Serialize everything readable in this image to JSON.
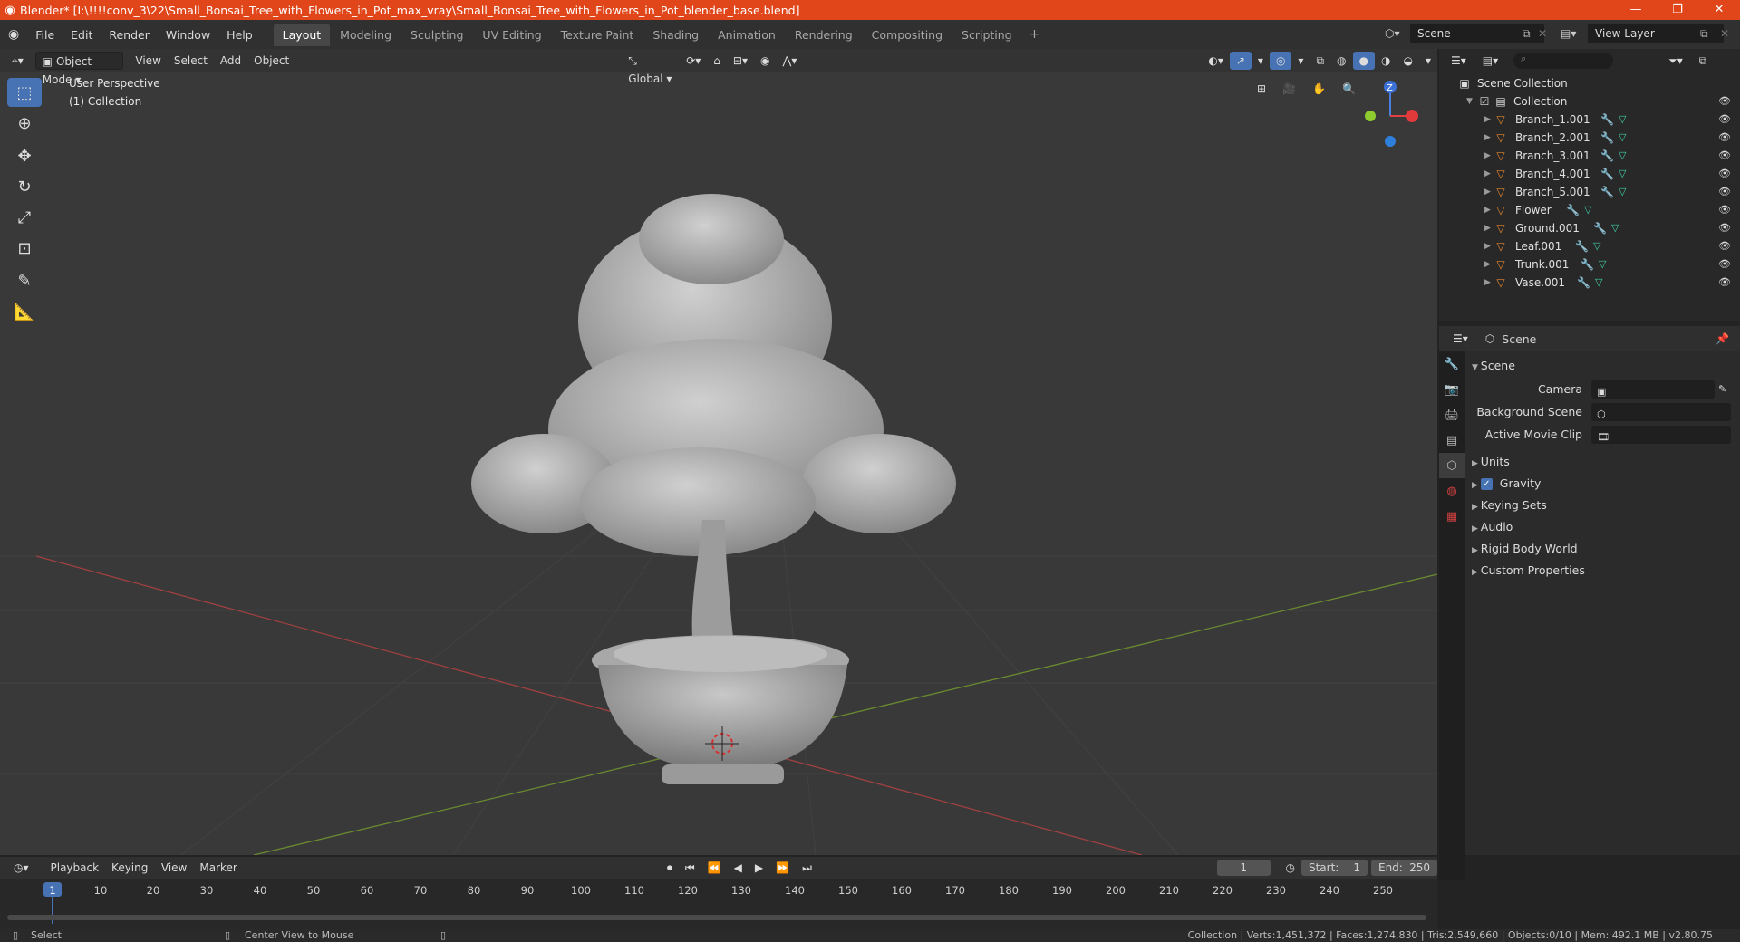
{
  "window": {
    "title": "Blender* [I:\\!!!!conv_3\\22\\Small_Bonsai_Tree_with_Flowers_in_Pot_max_vray\\Small_Bonsai_Tree_with_Flowers_in_Pot_blender_base.blend]",
    "minimize": "—",
    "maximize": "❐",
    "close": "✕"
  },
  "menubar": {
    "menus": [
      "File",
      "Edit",
      "Render",
      "Window",
      "Help"
    ],
    "workspaces": [
      "Layout",
      "Modeling",
      "Sculpting",
      "UV Editing",
      "Texture Paint",
      "Shading",
      "Animation",
      "Rendering",
      "Compositing",
      "Scripting"
    ],
    "active_workspace": "Layout",
    "scene": "Scene",
    "view_layer": "View Layer"
  },
  "viewport": {
    "mode": "Object Mode",
    "menus": [
      "View",
      "Select",
      "Add",
      "Object"
    ],
    "orientation": "Global",
    "perspective_label": "User Perspective",
    "collection_label": "(1) Collection",
    "gizmo_z": "Z"
  },
  "outliner": {
    "root": "Scene Collection",
    "collection": "Collection",
    "objects": [
      "Branch_1.001",
      "Branch_2.001",
      "Branch_3.001",
      "Branch_4.001",
      "Branch_5.001",
      "Flower",
      "Ground.001",
      "Leaf.001",
      "Trunk.001",
      "Vase.001"
    ]
  },
  "properties": {
    "header": "Scene",
    "section": "Scene",
    "camera_label": "Camera",
    "background_scene_label": "Background Scene",
    "active_movie_clip_label": "Active Movie Clip",
    "panels": [
      "Units",
      "Gravity",
      "Keying Sets",
      "Audio",
      "Rigid Body World",
      "Custom Properties"
    ]
  },
  "timeline": {
    "menus": [
      "Playback",
      "Keying",
      "View",
      "Marker"
    ],
    "current_frame": "1",
    "start_label": "Start:",
    "start": "1",
    "end_label": "End:",
    "end": "250",
    "ruler": [
      "1",
      "10",
      "20",
      "30",
      "40",
      "50",
      "60",
      "70",
      "80",
      "90",
      "100",
      "110",
      "120",
      "130",
      "140",
      "150",
      "160",
      "170",
      "180",
      "190",
      "200",
      "210",
      "220",
      "230",
      "240",
      "250"
    ]
  },
  "statusbar": {
    "select": "Select",
    "center_view": "Center View to Mouse",
    "stats": "Collection | Verts:1,451,372 | Faces:1,274,830 | Tris:2,549,660 | Objects:0/10 | Mem: 492.1 MB | v2.80.75"
  },
  "colors": {
    "titlebar": "#e0461a",
    "accent": "#4772b3",
    "object_icon": "#e8862e",
    "mesh_icon": "#3fd1a8",
    "modifier_icon": "#6aa0e0"
  }
}
